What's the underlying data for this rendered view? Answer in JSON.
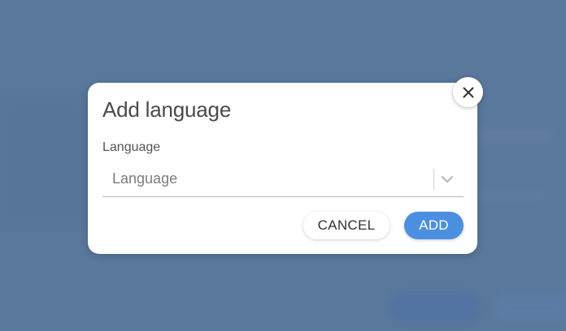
{
  "dialog": {
    "title": "Add language",
    "field_label": "Language",
    "select": {
      "placeholder": "Language",
      "icon": "chevron-down-icon"
    },
    "buttons": {
      "cancel_label": "CANCEL",
      "add_label": "ADD"
    },
    "close_icon": "close-icon"
  },
  "colors": {
    "backdrop": "#5a789c",
    "dialog_background": "#ffffff",
    "primary_button": "#4a8fe0",
    "title_text": "#4a4a4a"
  }
}
